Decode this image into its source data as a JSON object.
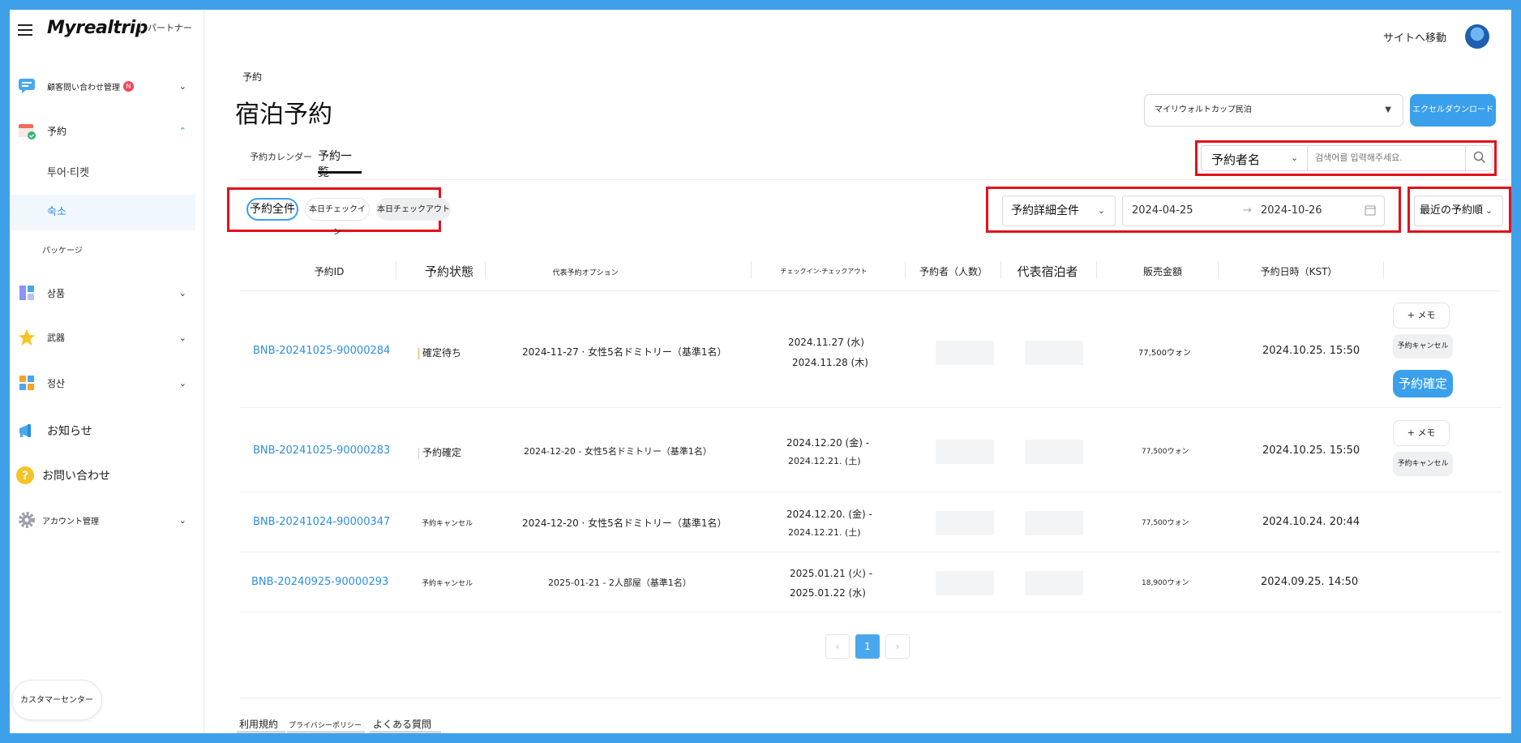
{
  "sidebar": {
    "logo": "Myrealtrip",
    "partner_tag": "パートナー",
    "items": [
      {
        "label": "顧客問い合わせ管理",
        "badge": "N"
      },
      {
        "label": "予約"
      },
      {
        "label": "상품"
      },
      {
        "label": "武器"
      },
      {
        "label": "정산"
      },
      {
        "label": "お知らせ"
      },
      {
        "label": "お問い合わせ"
      },
      {
        "label": "アカウント管理"
      }
    ],
    "sub_items": [
      {
        "label": "투어·티켓"
      },
      {
        "label": "숙소"
      },
      {
        "label": "パッケージ"
      }
    ],
    "customer_center": "カスタマーセンター"
  },
  "header": {
    "goto_site": "サイトへ移動"
  },
  "page": {
    "breadcrumb": "予約",
    "title": "宿泊予約",
    "tabs": [
      {
        "label": "予約カレンダー"
      },
      {
        "label": "予約一覧"
      }
    ],
    "property_select": "マイリウォルトカップ民泊",
    "excel_button": "エクセルダウンロード"
  },
  "search": {
    "type": "予約者名",
    "placeholder": "검색어를 입력해주세요."
  },
  "filters": {
    "pills": [
      "予約全件",
      "本日チェックイン",
      "本日チェックアウト"
    ],
    "detail_select": "予約詳細全件",
    "date_from": "2024-04-25",
    "date_to": "2024-10-26",
    "sort": "最近の予約順"
  },
  "table": {
    "headers": [
      "予約ID",
      "予約状態",
      "代表予約オプション",
      "チェックイン-チェックアウト",
      "予約者（人数）",
      "代表宿泊者",
      "販売金額",
      "予約日時（KST）"
    ],
    "rows": [
      {
        "id": "BNB-20241025-90000284",
        "status": "確定待ち",
        "option": "2024-11-27 · 女性5名ドミトリー（基準1名）",
        "checkin": "2024.11.27 (水)",
        "checkout": "2024.11.28 (木)",
        "amount": "77,500ウォン",
        "date": "2024.10.25. 15:50"
      },
      {
        "id": "BNB-20241025-90000283",
        "status": "予約確定",
        "option": "2024-12-20 - 女性5名ドミトリー（基準1名）",
        "checkin": "2024.12.20 (金) -",
        "checkout": "2024.12.21. (土)",
        "amount": "77,500ウォン",
        "date": "2024.10.25. 15:50"
      },
      {
        "id": "BNB-20241024-90000347",
        "status": "予約キャンセル",
        "option": "2024-12-20 · 女性5名ドミトリー（基準1名）",
        "checkin": "2024.12.20. (金) -",
        "checkout": "2024.12.21. (土)",
        "amount": "77,500ウォン",
        "date": "2024.10.24. 20:44"
      },
      {
        "id": "BNB-20240925-90000293",
        "status": "予約キャンセル",
        "option": "2025-01-21 - 2人部屋（基準1名）",
        "checkin": "2025.01.21 (火) -",
        "checkout": "2025.01.22 (水)",
        "amount": "18,900ウォン",
        "date": "2024.09.25. 14:50"
      }
    ],
    "memo_label": "+ メモ",
    "cancel_label": "予約キャンセル",
    "confirm_label": "予約確定"
  },
  "pagination": {
    "prev": "‹",
    "current": "1",
    "next": "›"
  },
  "footer": {
    "links": [
      "利用規約",
      "プライバシーポリシー",
      "よくある質問"
    ]
  }
}
